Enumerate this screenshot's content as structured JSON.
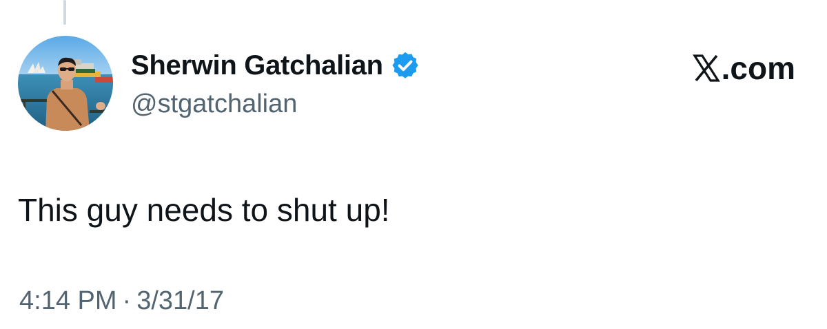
{
  "author": {
    "display_name": "Sherwin Gatchalian",
    "handle": "@stgatchalian",
    "verified": true,
    "verified_icon": "verified-badge-icon",
    "avatar": "profile-photo"
  },
  "brand": {
    "label": ".com",
    "icon": "x-logo-icon"
  },
  "tweet": {
    "text": "This guy needs to shut up!",
    "time": "4:14 PM",
    "separator": "·",
    "date": "3/31/17"
  },
  "colors": {
    "text_primary": "#0f1419",
    "text_secondary": "#536471",
    "verified_blue": "#1d9bf0",
    "thread_line": "#cfd9de"
  }
}
